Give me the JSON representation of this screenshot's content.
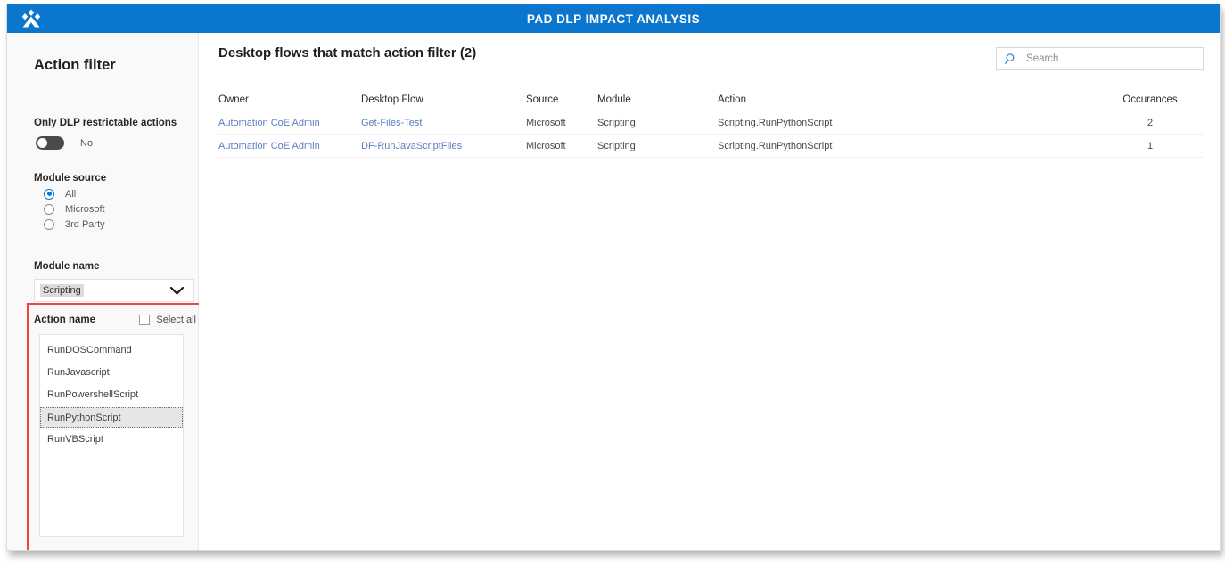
{
  "header": {
    "title": "PAD DLP IMPACT ANALYSIS",
    "logo_icon": "power-platform-diamond-logo",
    "background_color": "#0b76cd"
  },
  "sidebar": {
    "title": "Action filter",
    "dlp_toggle": {
      "label": "Only DLP restrictable actions",
      "value": "No",
      "state": "off"
    },
    "module_source": {
      "label": "Module source",
      "options": [
        "All",
        "Microsoft",
        "3rd Party"
      ],
      "selected": "All"
    },
    "module_name": {
      "label": "Module name",
      "selected": "Scripting",
      "chevron_icon": "chevron-down-icon"
    },
    "action_name": {
      "label": "Action name",
      "select_all_label": "Select all",
      "select_all_checked": false,
      "options": [
        "RunDOSCommand",
        "RunJavascript",
        "RunPowershellScript",
        "RunPythonScript",
        "RunVBScript"
      ],
      "selected": "RunPythonScript"
    },
    "annotation_color": "#f4433a"
  },
  "main": {
    "title": "Desktop flows that match action filter (2)",
    "search": {
      "placeholder": "Search",
      "value": "",
      "icon": "search-icon"
    },
    "table": {
      "columns": [
        "Owner",
        "Desktop Flow",
        "Source",
        "Module",
        "Action",
        "Occurances"
      ],
      "rows": [
        {
          "owner": "Automation CoE Admin",
          "desktop_flow": "Get-Files-Test",
          "source": "Microsoft",
          "module": "Scripting",
          "action": "Scripting.RunPythonScript",
          "occurances": "2"
        },
        {
          "owner": "Automation CoE Admin",
          "desktop_flow": "DF-RunJavaScriptFiles",
          "source": "Microsoft",
          "module": "Scripting",
          "action": "Scripting.RunPythonScript",
          "occurances": "1"
        }
      ]
    }
  }
}
